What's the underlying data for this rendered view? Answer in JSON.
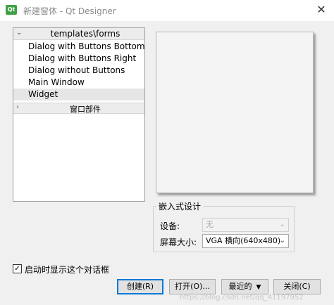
{
  "window": {
    "title": "新建窗体 - Qt Designer",
    "app_icon_text": "Qt",
    "close_symbol": "✕"
  },
  "tree": {
    "header_label": "templates\\forms",
    "header_chevron": "⌄",
    "items": [
      {
        "label": "Dialog with Buttons Bottom"
      },
      {
        "label": "Dialog with Buttons Right"
      },
      {
        "label": "Dialog without Buttons"
      },
      {
        "label": "Main Window"
      },
      {
        "label": "Widget",
        "selected": true
      }
    ],
    "section2_label": "窗口部件",
    "section2_chevron": "›"
  },
  "embedded": {
    "group_title": "嵌入式设计",
    "device_label": "设备:",
    "device_value": "无",
    "screen_size_label": "屏幕大小:",
    "screen_size_value": "VGA 横向(640x480)"
  },
  "startup_checkbox": {
    "checked": true,
    "check_symbol": "✓",
    "label": "启动时显示这个对话框"
  },
  "buttons": {
    "create": "创建(R)",
    "open": "打开(O)...",
    "recent": "最近的",
    "close": "关闭(C)",
    "dropdown_symbol": "▼"
  },
  "watermark": "https://blog.csdn.net/qq_41197952",
  "colors": {
    "default_button_border": "#0078d7",
    "title_text": "#8a8a8a",
    "qt_icon": "#3ea145"
  }
}
